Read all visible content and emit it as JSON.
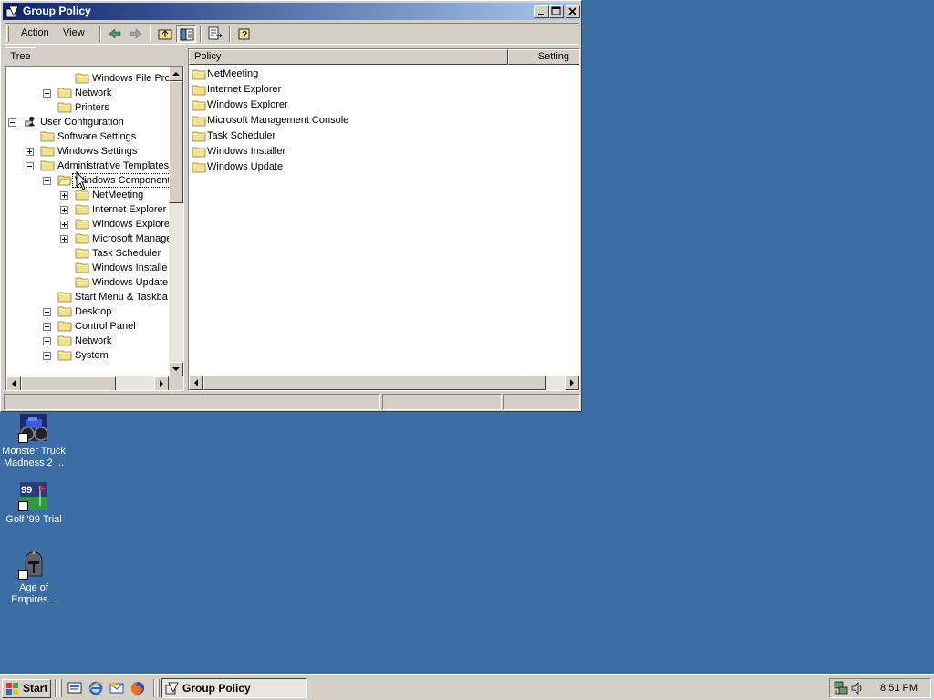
{
  "window": {
    "title": "Group Policy",
    "menu": {
      "action": "Action",
      "view": "View"
    },
    "tree_tab": "Tree",
    "tree_items": [
      {
        "label": "Windows File Pro",
        "indent": 4,
        "expander": "none"
      },
      {
        "label": "Network",
        "indent": 3,
        "expander": "plus"
      },
      {
        "label": "Printers",
        "indent": 3,
        "expander": "none"
      },
      {
        "label": "User Configuration",
        "indent": 1,
        "expander": "minus",
        "icon": "user"
      },
      {
        "label": "Software Settings",
        "indent": 2,
        "expander": "none"
      },
      {
        "label": "Windows Settings",
        "indent": 2,
        "expander": "plus"
      },
      {
        "label": "Administrative Templates",
        "indent": 2,
        "expander": "minus"
      },
      {
        "label": "Windows Components",
        "indent": 3,
        "expander": "minus",
        "selected": true,
        "open": true
      },
      {
        "label": "NetMeeting",
        "indent": 4,
        "expander": "plus"
      },
      {
        "label": "Internet Explorer",
        "indent": 4,
        "expander": "plus"
      },
      {
        "label": "Windows Explore",
        "indent": 4,
        "expander": "plus"
      },
      {
        "label": "Microsoft Manage",
        "indent": 4,
        "expander": "plus"
      },
      {
        "label": "Task Scheduler",
        "indent": 4,
        "expander": "none"
      },
      {
        "label": "Windows Installe",
        "indent": 4,
        "expander": "none"
      },
      {
        "label": "Windows Update",
        "indent": 4,
        "expander": "none"
      },
      {
        "label": "Start Menu & Taskba",
        "indent": 3,
        "expander": "none"
      },
      {
        "label": "Desktop",
        "indent": 3,
        "expander": "plus"
      },
      {
        "label": "Control Panel",
        "indent": 3,
        "expander": "plus"
      },
      {
        "label": "Network",
        "indent": 3,
        "expander": "plus"
      },
      {
        "label": "System",
        "indent": 3,
        "expander": "plus"
      }
    ],
    "list": {
      "columns": [
        "Policy",
        "Setting"
      ],
      "items": [
        "NetMeeting",
        "Internet Explorer",
        "Windows Explorer",
        "Microsoft Management Console",
        "Task Scheduler",
        "Windows Installer",
        "Windows Update"
      ]
    }
  },
  "desktop_icons": [
    {
      "label": "Monster Truck Madness 2 ...",
      "icon": "truck-icon"
    },
    {
      "label": "Golf '99 Trial",
      "icon": "golf-icon"
    },
    {
      "label": "Age of Empires...",
      "icon": "helmet-icon"
    }
  ],
  "taskbar": {
    "start_label": "Start",
    "task_label": "Group Policy",
    "clock": "8:51 PM"
  },
  "colors": {
    "desktop": "#3a6ea5",
    "title_active_start": "#0a246a",
    "title_active_end": "#a6caf0",
    "face": "#d4d0c8",
    "folder": "#f3e18b"
  }
}
